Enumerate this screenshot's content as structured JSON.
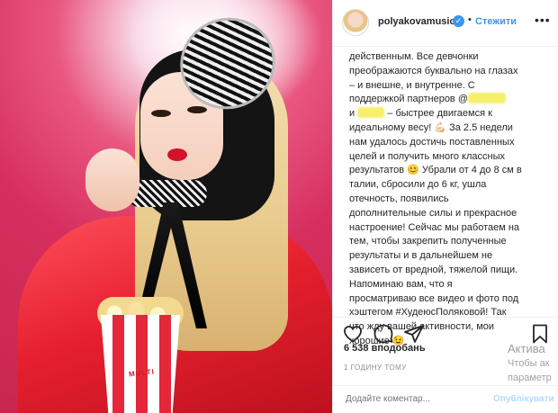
{
  "header": {
    "username": "polyakovamusic",
    "verified_glyph": "✓",
    "separator": "•",
    "follow_label": "Стежити",
    "more_glyph": "•••"
  },
  "caption": {
    "lines": [
      "действенным. Все девчонки",
      "преображаются буквально на глазах",
      "– и внешне, и внутренне. С",
      "поддержкой партнеров @",
      "и",
      "– быстрее двигаемся к",
      "идеальному весу! 💪🏻 За 2.5 недели",
      "нам удалось достичь поставленных",
      "целей и получить много классных",
      "результатов 😊 Убрали от 4 до 8 см в",
      "талии, сбросили до 6 кг, ушла",
      "отечность, появились",
      "дополнительные силы и прекрасное",
      "настроение! Сейчас мы работаем на",
      "тем, чтобы закрепить полученные",
      "результаты и в дальнейшем не",
      "зависеть от вредной, тяжелой пищи.",
      "Напоминаю вам, что я",
      "просматриваю все видео и фото под",
      "хэштегом #ХудеюсПоляковой! Так",
      "что жду вашей активности, мои",
      "хорошие 😉"
    ]
  },
  "photo": {
    "bucket_text": "MULTI"
  },
  "stats": {
    "likes": "6 538 вподобань",
    "time": "1 ГОДИНУ ТОМУ"
  },
  "comment": {
    "placeholder": "Додайте коментар...",
    "publish_label": "Опублікувати"
  },
  "watermark": {
    "line1": "Актива",
    "line2": "Чтобы ак",
    "line3": "параметр"
  },
  "icons": [
    "heart-icon",
    "comment-icon",
    "share-icon",
    "bookmark-icon",
    "verified-badge-icon"
  ]
}
